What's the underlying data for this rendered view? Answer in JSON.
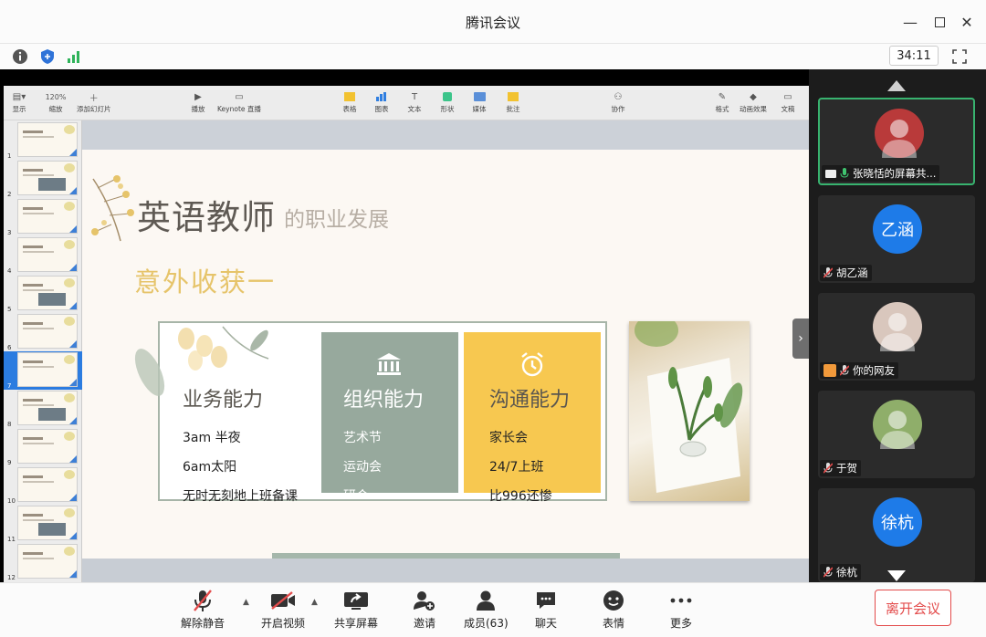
{
  "window": {
    "title": "腾讯会议",
    "timer": "34:11"
  },
  "keynote_toolbar": {
    "view": "显示",
    "zoom_value": "120%",
    "zoom": "缩放",
    "add_slide": "添加幻灯片",
    "play": "播放",
    "keynote_live": "Keynote 直播",
    "table": "表格",
    "chart": "图表",
    "text": "文本",
    "shape": "形状",
    "media": "媒体",
    "comment": "批注",
    "collaborate": "协作",
    "format": "格式",
    "animate": "动画效果",
    "document": "文稿"
  },
  "navigator": {
    "slides": [
      "1",
      "2",
      "3",
      "4",
      "5",
      "6",
      "7",
      "8",
      "9",
      "10",
      "11",
      "12"
    ],
    "selected": "7"
  },
  "slide": {
    "title": "英语教师",
    "title_suffix": "的职业发展",
    "heading": "意外收获一",
    "columns": [
      {
        "title": "业务能力",
        "items": [
          "3am 半夜",
          "6am太阳",
          "无时无刻地上班备课"
        ]
      },
      {
        "title": "组织能力",
        "items": [
          "艺术节",
          "运动会",
          "研会"
        ],
        "icon": "bank-icon"
      },
      {
        "title": "沟通能力",
        "items": [
          "家长会",
          "24/7上班",
          "比996还惨"
        ],
        "icon": "alarm-clock-icon"
      }
    ],
    "colors": {
      "green": "#97a99d",
      "yellow": "#f7c850",
      "heading": "#e6c46a"
    }
  },
  "participants": [
    {
      "name": "张晓恬的屏幕共...",
      "avatar_text": "",
      "color": "#b93a3a",
      "active": true
    },
    {
      "name": "胡乙涵",
      "avatar_text": "乙涵",
      "color": "#1e7be8"
    },
    {
      "name": "你的网友",
      "avatar_text": "",
      "color": "#d9c7bd"
    },
    {
      "name": "于贺",
      "avatar_text": "",
      "color": "#8fae6a"
    },
    {
      "name": "徐杭",
      "avatar_text": "徐杭",
      "color": "#1e7be8"
    }
  ],
  "toolbar": {
    "unmute": "解除静音",
    "start_video": "开启视频",
    "share": "共享屏幕",
    "invite": "邀请",
    "members": "成员(63)",
    "chat": "聊天",
    "reaction": "表情",
    "more": "更多",
    "leave": "离开会议"
  }
}
